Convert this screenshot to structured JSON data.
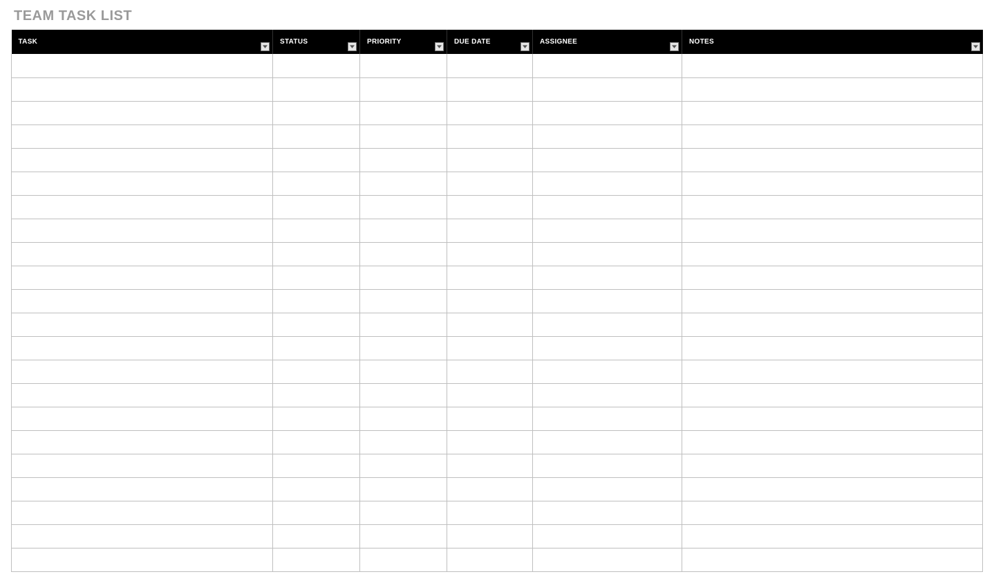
{
  "title": "TEAM TASK LIST",
  "columns": [
    {
      "label": "TASK"
    },
    {
      "label": "STATUS"
    },
    {
      "label": "PRIORITY"
    },
    {
      "label": "DUE DATE"
    },
    {
      "label": "ASSIGNEE"
    },
    {
      "label": "NOTES"
    }
  ],
  "rows": [
    {
      "task": "",
      "status": "",
      "priority": "",
      "due_date": "",
      "assignee": "",
      "notes": ""
    },
    {
      "task": "",
      "status": "",
      "priority": "",
      "due_date": "",
      "assignee": "",
      "notes": ""
    },
    {
      "task": "",
      "status": "",
      "priority": "",
      "due_date": "",
      "assignee": "",
      "notes": ""
    },
    {
      "task": "",
      "status": "",
      "priority": "",
      "due_date": "",
      "assignee": "",
      "notes": ""
    },
    {
      "task": "",
      "status": "",
      "priority": "",
      "due_date": "",
      "assignee": "",
      "notes": ""
    },
    {
      "task": "",
      "status": "",
      "priority": "",
      "due_date": "",
      "assignee": "",
      "notes": ""
    },
    {
      "task": "",
      "status": "",
      "priority": "",
      "due_date": "",
      "assignee": "",
      "notes": ""
    },
    {
      "task": "",
      "status": "",
      "priority": "",
      "due_date": "",
      "assignee": "",
      "notes": ""
    },
    {
      "task": "",
      "status": "",
      "priority": "",
      "due_date": "",
      "assignee": "",
      "notes": ""
    },
    {
      "task": "",
      "status": "",
      "priority": "",
      "due_date": "",
      "assignee": "",
      "notes": ""
    },
    {
      "task": "",
      "status": "",
      "priority": "",
      "due_date": "",
      "assignee": "",
      "notes": ""
    },
    {
      "task": "",
      "status": "",
      "priority": "",
      "due_date": "",
      "assignee": "",
      "notes": ""
    },
    {
      "task": "",
      "status": "",
      "priority": "",
      "due_date": "",
      "assignee": "",
      "notes": ""
    },
    {
      "task": "",
      "status": "",
      "priority": "",
      "due_date": "",
      "assignee": "",
      "notes": ""
    },
    {
      "task": "",
      "status": "",
      "priority": "",
      "due_date": "",
      "assignee": "",
      "notes": ""
    },
    {
      "task": "",
      "status": "",
      "priority": "",
      "due_date": "",
      "assignee": "",
      "notes": ""
    },
    {
      "task": "",
      "status": "",
      "priority": "",
      "due_date": "",
      "assignee": "",
      "notes": ""
    },
    {
      "task": "",
      "status": "",
      "priority": "",
      "due_date": "",
      "assignee": "",
      "notes": ""
    },
    {
      "task": "",
      "status": "",
      "priority": "",
      "due_date": "",
      "assignee": "",
      "notes": ""
    },
    {
      "task": "",
      "status": "",
      "priority": "",
      "due_date": "",
      "assignee": "",
      "notes": ""
    },
    {
      "task": "",
      "status": "",
      "priority": "",
      "due_date": "",
      "assignee": "",
      "notes": ""
    },
    {
      "task": "",
      "status": "",
      "priority": "",
      "due_date": "",
      "assignee": "",
      "notes": ""
    }
  ]
}
